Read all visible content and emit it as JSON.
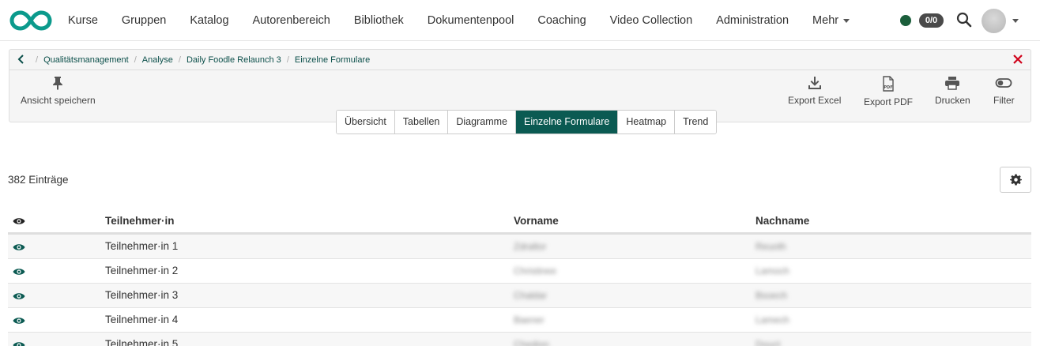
{
  "nav": {
    "items": [
      "Kurse",
      "Gruppen",
      "Katalog",
      "Autorenbereich",
      "Bibliothek",
      "Dokumentenpool",
      "Coaching",
      "Video Collection",
      "Administration",
      "Mehr"
    ],
    "counter": "0/0",
    "accent": "#0b5a52"
  },
  "breadcrumb": [
    "Qualitätsmanagement",
    "Analyse",
    "Daily Foodle Relaunch 3",
    "Einzelne Formulare"
  ],
  "toolbar": {
    "save_view": "Ansicht speichern",
    "export_excel": "Export Excel",
    "export_pdf": "Export PDF",
    "print": "Drucken",
    "filter": "Filter"
  },
  "tabs": [
    "Übersicht",
    "Tabellen",
    "Diagramme",
    "Einzelne Formulare",
    "Heatmap",
    "Trend"
  ],
  "active_tab": "Einzelne Formulare",
  "list": {
    "count": "382 Einträge",
    "columns": [
      "Teilnehmer·in",
      "Vorname",
      "Nachname"
    ],
    "rows": [
      {
        "participant": "Teilnehmer·in 1",
        "first": "Zdraltor",
        "last": "Reuoth"
      },
      {
        "participant": "Teilnehmer·in 2",
        "first": "Christinee",
        "last": "Lamoch"
      },
      {
        "participant": "Teilnehmer·in 3",
        "first": "Chaldar",
        "last": "Bsoech"
      },
      {
        "participant": "Teilnehmer·in 4",
        "first": "Baener",
        "last": "Lamech"
      },
      {
        "participant": "Teilnehmer·in 5",
        "first": "Chedion",
        "last": "Douct"
      }
    ]
  }
}
